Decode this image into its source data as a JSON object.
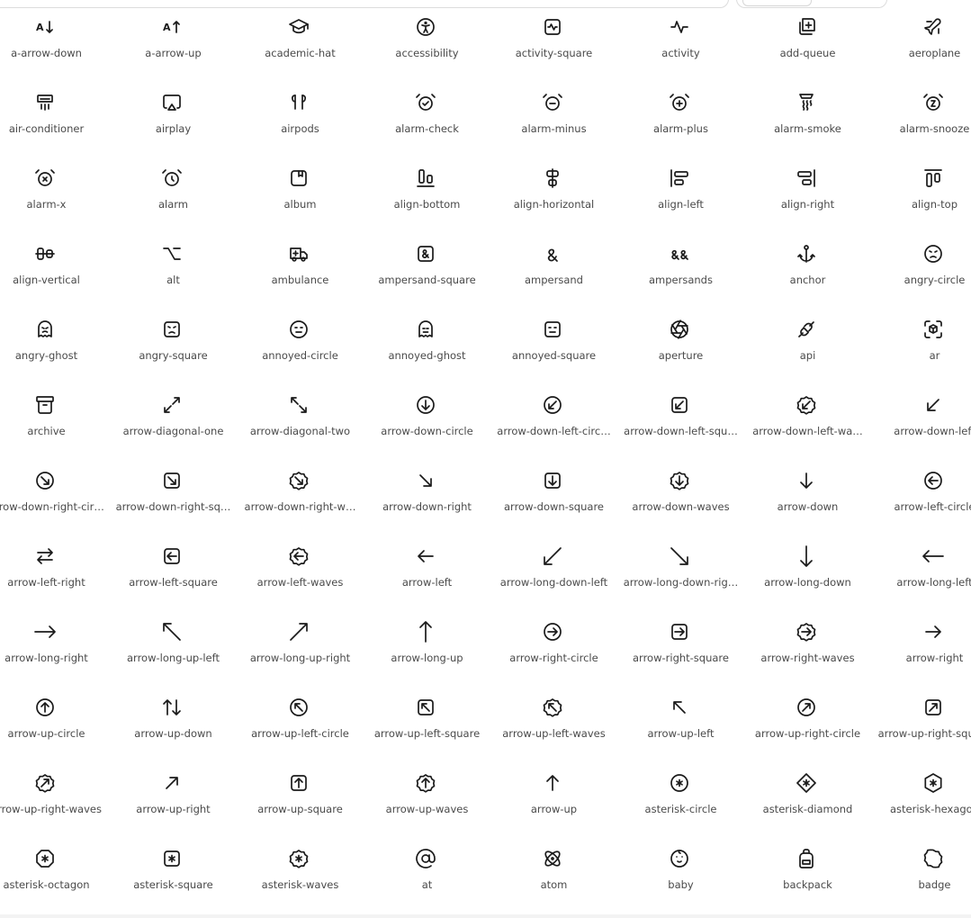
{
  "colors": {
    "icon": "#1b1b1b",
    "label": "#4a4a4a",
    "border": "#dcdcdc",
    "background": "#ffffff"
  },
  "icons": [
    {
      "name": "a-arrow-down",
      "label": "a-arrow-down",
      "glyph": "text-down"
    },
    {
      "name": "a-arrow-up",
      "label": "a-arrow-up",
      "glyph": "text-up"
    },
    {
      "name": "academic-hat",
      "label": "academic-hat",
      "glyph": "hat"
    },
    {
      "name": "accessibility",
      "label": "accessibility",
      "glyph": "accessibility"
    },
    {
      "name": "activity-square",
      "label": "activity-square",
      "glyph": "activity-square"
    },
    {
      "name": "activity",
      "label": "activity",
      "glyph": "activity"
    },
    {
      "name": "add-queue",
      "label": "add-queue",
      "glyph": "add-queue"
    },
    {
      "name": "aeroplane",
      "label": "aeroplane",
      "glyph": "plane"
    },
    {
      "name": "air-conditioner",
      "label": "air-conditioner",
      "glyph": "aircon"
    },
    {
      "name": "airplay",
      "label": "airplay",
      "glyph": "airplay"
    },
    {
      "name": "airpods",
      "label": "airpods",
      "glyph": "airpods"
    },
    {
      "name": "alarm-check",
      "label": "alarm-check",
      "glyph": "alarm-check"
    },
    {
      "name": "alarm-minus",
      "label": "alarm-minus",
      "glyph": "alarm-minus"
    },
    {
      "name": "alarm-plus",
      "label": "alarm-plus",
      "glyph": "alarm-plus"
    },
    {
      "name": "alarm-smoke",
      "label": "alarm-smoke",
      "glyph": "alarm-smoke"
    },
    {
      "name": "alarm-snooze",
      "label": "alarm-snooze",
      "glyph": "alarm-snooze"
    },
    {
      "name": "alarm-x",
      "label": "alarm-x",
      "glyph": "alarm-x"
    },
    {
      "name": "alarm",
      "label": "alarm",
      "glyph": "alarm"
    },
    {
      "name": "album",
      "label": "album",
      "glyph": "album"
    },
    {
      "name": "align-bottom",
      "label": "align-bottom",
      "glyph": "align-bottom"
    },
    {
      "name": "align-horizontal",
      "label": "align-horizontal",
      "glyph": "align-horizontal"
    },
    {
      "name": "align-left",
      "label": "align-left",
      "glyph": "align-left"
    },
    {
      "name": "align-right",
      "label": "align-right",
      "glyph": "align-right"
    },
    {
      "name": "align-top",
      "label": "align-top",
      "glyph": "align-top"
    },
    {
      "name": "align-vertical",
      "label": "align-vertical",
      "glyph": "align-vertical"
    },
    {
      "name": "alt",
      "label": "alt",
      "glyph": "alt"
    },
    {
      "name": "ambulance",
      "label": "ambulance",
      "glyph": "ambulance"
    },
    {
      "name": "ampersand-square",
      "label": "ampersand-square",
      "glyph": "amp-square"
    },
    {
      "name": "ampersand",
      "label": "ampersand",
      "glyph": "amp"
    },
    {
      "name": "ampersands",
      "label": "ampersands",
      "glyph": "amps"
    },
    {
      "name": "anchor",
      "label": "anchor",
      "glyph": "anchor"
    },
    {
      "name": "angry-circle",
      "label": "angry-circle",
      "glyph": "angry-circle"
    },
    {
      "name": "angry-ghost",
      "label": "angry-ghost",
      "glyph": "angry-ghost"
    },
    {
      "name": "angry-square",
      "label": "angry-square",
      "glyph": "angry-square"
    },
    {
      "name": "annoyed-circle",
      "label": "annoyed-circle",
      "glyph": "annoyed-circle"
    },
    {
      "name": "annoyed-ghost",
      "label": "annoyed-ghost",
      "glyph": "annoyed-ghost"
    },
    {
      "name": "annoyed-square",
      "label": "annoyed-square",
      "glyph": "annoyed-square"
    },
    {
      "name": "aperture",
      "label": "aperture",
      "glyph": "aperture"
    },
    {
      "name": "api",
      "label": "api",
      "glyph": "api"
    },
    {
      "name": "ar",
      "label": "ar",
      "glyph": "ar"
    },
    {
      "name": "archive",
      "label": "archive",
      "glyph": "archive"
    },
    {
      "name": "arrow-diagonal-one",
      "label": "arrow-diagonal-one",
      "glyph": "diag-one"
    },
    {
      "name": "arrow-diagonal-two",
      "label": "arrow-diagonal-two",
      "glyph": "diag-two"
    },
    {
      "name": "arrow-down-circle",
      "label": "arrow-down-circle",
      "glyph": "circle-down"
    },
    {
      "name": "arrow-down-left-circle",
      "label": "arrow-down-left-circ…",
      "glyph": "circle-down-left"
    },
    {
      "name": "arrow-down-left-square",
      "label": "arrow-down-left-squ…",
      "glyph": "square-down-left"
    },
    {
      "name": "arrow-down-left-waves",
      "label": "arrow-down-left-wa…",
      "glyph": "waves-down-left"
    },
    {
      "name": "arrow-down-left",
      "label": "arrow-down-left",
      "glyph": "down-left"
    },
    {
      "name": "arrow-down-right-circle",
      "label": "arrow-down-right-cir…",
      "glyph": "circle-down-right"
    },
    {
      "name": "arrow-down-right-square",
      "label": "arrow-down-right-sq…",
      "glyph": "square-down-right"
    },
    {
      "name": "arrow-down-right-waves",
      "label": "arrow-down-right-w…",
      "glyph": "waves-down-right"
    },
    {
      "name": "arrow-down-right",
      "label": "arrow-down-right",
      "glyph": "down-right"
    },
    {
      "name": "arrow-down-square",
      "label": "arrow-down-square",
      "glyph": "square-down"
    },
    {
      "name": "arrow-down-waves",
      "label": "arrow-down-waves",
      "glyph": "waves-down"
    },
    {
      "name": "arrow-down",
      "label": "arrow-down",
      "glyph": "down"
    },
    {
      "name": "arrow-left-circle",
      "label": "arrow-left-circle",
      "glyph": "circle-left"
    },
    {
      "name": "arrow-left-right",
      "label": "arrow-left-right",
      "glyph": "left-right"
    },
    {
      "name": "arrow-left-square",
      "label": "arrow-left-square",
      "glyph": "square-left"
    },
    {
      "name": "arrow-left-waves",
      "label": "arrow-left-waves",
      "glyph": "waves-left"
    },
    {
      "name": "arrow-left",
      "label": "arrow-left",
      "glyph": "left"
    },
    {
      "name": "arrow-long-down-left",
      "label": "arrow-long-down-left",
      "glyph": "long-down-left"
    },
    {
      "name": "arrow-long-down-right",
      "label": "arrow-long-down-rig…",
      "glyph": "long-down-right"
    },
    {
      "name": "arrow-long-down",
      "label": "arrow-long-down",
      "glyph": "long-down"
    },
    {
      "name": "arrow-long-left",
      "label": "arrow-long-left",
      "glyph": "long-left"
    },
    {
      "name": "arrow-long-right",
      "label": "arrow-long-right",
      "glyph": "long-right"
    },
    {
      "name": "arrow-long-up-left",
      "label": "arrow-long-up-left",
      "glyph": "long-up-left"
    },
    {
      "name": "arrow-long-up-right",
      "label": "arrow-long-up-right",
      "glyph": "long-up-right"
    },
    {
      "name": "arrow-long-up",
      "label": "arrow-long-up",
      "glyph": "long-up"
    },
    {
      "name": "arrow-right-circle",
      "label": "arrow-right-circle",
      "glyph": "circle-right"
    },
    {
      "name": "arrow-right-square",
      "label": "arrow-right-square",
      "glyph": "square-right"
    },
    {
      "name": "arrow-right-waves",
      "label": "arrow-right-waves",
      "glyph": "waves-right"
    },
    {
      "name": "arrow-right",
      "label": "arrow-right",
      "glyph": "right"
    },
    {
      "name": "arrow-up-circle",
      "label": "arrow-up-circle",
      "glyph": "circle-up"
    },
    {
      "name": "arrow-up-down",
      "label": "arrow-up-down",
      "glyph": "up-down"
    },
    {
      "name": "arrow-up-left-circle",
      "label": "arrow-up-left-circle",
      "glyph": "circle-up-left"
    },
    {
      "name": "arrow-up-left-square",
      "label": "arrow-up-left-square",
      "glyph": "square-up-left"
    },
    {
      "name": "arrow-up-left-waves",
      "label": "arrow-up-left-waves",
      "glyph": "waves-up-left"
    },
    {
      "name": "arrow-up-left",
      "label": "arrow-up-left",
      "glyph": "up-left"
    },
    {
      "name": "arrow-up-right-circle",
      "label": "arrow-up-right-circle",
      "glyph": "circle-up-right"
    },
    {
      "name": "arrow-up-right-square",
      "label": "arrow-up-right-square",
      "glyph": "square-up-right"
    },
    {
      "name": "arrow-up-right-waves",
      "label": "arrow-up-right-waves",
      "glyph": "waves-up-right"
    },
    {
      "name": "arrow-up-right",
      "label": "arrow-up-right",
      "glyph": "up-right"
    },
    {
      "name": "arrow-up-square",
      "label": "arrow-up-square",
      "glyph": "square-up"
    },
    {
      "name": "arrow-up-waves",
      "label": "arrow-up-waves",
      "glyph": "waves-up"
    },
    {
      "name": "arrow-up",
      "label": "arrow-up",
      "glyph": "up"
    },
    {
      "name": "asterisk-circle",
      "label": "asterisk-circle",
      "glyph": "ast-circle"
    },
    {
      "name": "asterisk-diamond",
      "label": "asterisk-diamond",
      "glyph": "ast-diamond"
    },
    {
      "name": "asterisk-hexagon",
      "label": "asterisk-hexagon",
      "glyph": "ast-hexagon"
    },
    {
      "name": "asterisk-octagon",
      "label": "asterisk-octagon",
      "glyph": "ast-octagon"
    },
    {
      "name": "asterisk-square",
      "label": "asterisk-square",
      "glyph": "ast-square"
    },
    {
      "name": "asterisk-waves",
      "label": "asterisk-waves",
      "glyph": "ast-waves"
    },
    {
      "name": "at",
      "label": "at",
      "glyph": "at"
    },
    {
      "name": "atom",
      "label": "atom",
      "glyph": "atom"
    },
    {
      "name": "baby",
      "label": "baby",
      "glyph": "baby"
    },
    {
      "name": "backpack",
      "label": "backpack",
      "glyph": "backpack"
    },
    {
      "name": "badge",
      "label": "badge",
      "glyph": "badge"
    }
  ]
}
